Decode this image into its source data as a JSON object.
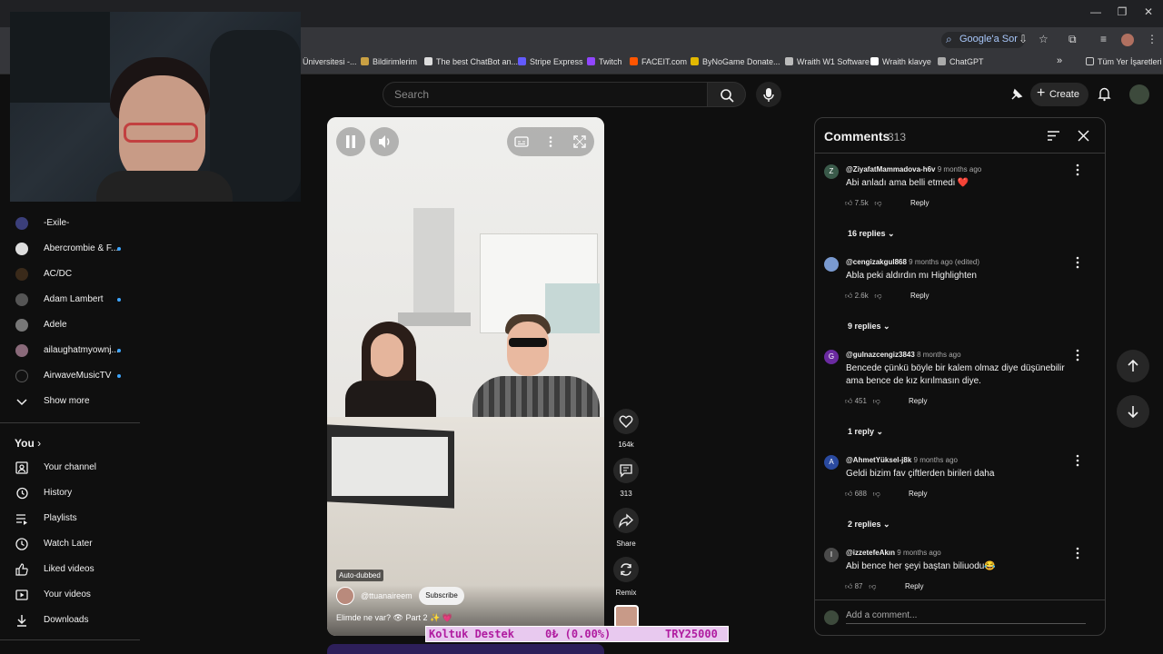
{
  "browser": {
    "address_button": "Google'a Sor",
    "bookmarks": [
      "Üniversitesi -...",
      "Bildirimlerim",
      "The best ChatBot an...",
      "Stripe Express",
      "Twitch",
      "FACEIT.com",
      "ByNoGame Donate...",
      "Wraith W1 Software",
      "Wraith klavye",
      "ChatGPT"
    ],
    "all_bookmarks": "Tüm Yer İşaretleri"
  },
  "header": {
    "search_placeholder": "Search",
    "create_label": "Create"
  },
  "sidebar": {
    "subscriptions": [
      {
        "name": "-Exile-",
        "dot": false,
        "color": "#3b3f7a"
      },
      {
        "name": "Abercrombie & F...",
        "dot": true,
        "color": "#dddddd"
      },
      {
        "name": "AC/DC",
        "dot": false,
        "color": "#3a2a1a"
      },
      {
        "name": "Adam Lambert",
        "dot": true,
        "color": "#555555"
      },
      {
        "name": "Adele",
        "dot": false,
        "color": "#777777"
      },
      {
        "name": "ailaughatmyownj...",
        "dot": true,
        "color": "#8a6a7a"
      },
      {
        "name": "AirwaveMusicTV",
        "dot": true,
        "color": "#111111"
      }
    ],
    "show_more": "Show more",
    "you_title": "You",
    "you_items": [
      "Your channel",
      "History",
      "Playlists",
      "Watch Later",
      "Liked videos",
      "Your videos",
      "Downloads"
    ]
  },
  "short": {
    "auto_dubbed": "Auto-dubbed",
    "channel": "@ttuanaireem",
    "subscribe": "Subscribe",
    "title": "Elimde ne var? 👁 Part 2 ✨ 💗",
    "likes": "164k",
    "comments": "313",
    "share": "Share",
    "remix": "Remix"
  },
  "overlay": {
    "label": "Koltuk Destek",
    "amount": "0₺ (0.00%)",
    "goal": "TRY25000"
  },
  "comments": {
    "title": "Comments",
    "count": "313",
    "add_placeholder": "Add a comment...",
    "reply_label": "Reply",
    "items": [
      {
        "avatar": "Z",
        "avatar_color": "#3a5a4a",
        "author": "@ZiyafatMammadova-h6v",
        "time": "9 months ago",
        "text": "Abi anladı ama belli etmedi ❤️",
        "likes": "7.5k",
        "replies": "16 replies"
      },
      {
        "avatar": "",
        "avatar_color": "#7a9ad0",
        "author": "@cengizakgul868",
        "time": "9 months ago (edited)",
        "text": "Abla peki aldırdın mı Highlighten",
        "likes": "2.6k",
        "replies": "9 replies"
      },
      {
        "avatar": "G",
        "avatar_color": "#6a2aa0",
        "author": "@gulnazcengiz3843",
        "time": "8 months ago",
        "text": "Bencede çünkü böyle bir kalem olmaz diye düşünebilir ama bence de kız kırılmasın diye.",
        "likes": "451",
        "replies": "1 reply"
      },
      {
        "avatar": "A",
        "avatar_color": "#2a4aa0",
        "author": "@AhmetYüksel-j8k",
        "time": "9 months ago",
        "text": "Geldi bizim fav çiftlerden birileri daha",
        "likes": "688",
        "replies": "2 replies"
      },
      {
        "avatar": "I",
        "avatar_color": "#4a4a4a",
        "author": "@izzetefeAkın",
        "time": "9 months ago",
        "text": "Abi bence her şeyi baştan biliuodu😂",
        "likes": "87",
        "replies": ""
      }
    ]
  }
}
